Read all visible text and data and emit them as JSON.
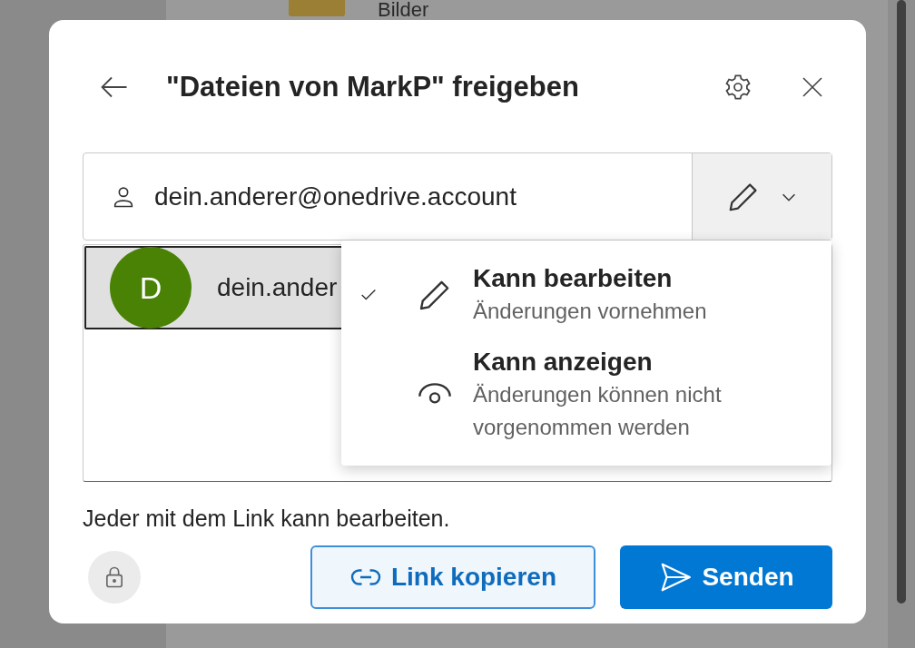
{
  "background": {
    "folder_label": "Bilder"
  },
  "dialog": {
    "title": "\"Dateien von MarkP\" freigeben",
    "recipient_field": {
      "value": "dein.anderer@onedrive.account"
    },
    "suggestion": {
      "initial": "D",
      "color": "#498205",
      "name": "dein.ander",
      "selected": true
    },
    "permission_menu": [
      {
        "kind": "edit",
        "title": "Kann bearbeiten",
        "description": "Änderungen vornehmen",
        "selected": true
      },
      {
        "kind": "view",
        "title": "Kann anzeigen",
        "description": "Änderungen können nicht vorgenommen werden",
        "selected": false
      }
    ],
    "link_info": "Jeder mit dem Link kann bearbeiten.",
    "buttons": [
      {
        "kind": "copy",
        "label": "Link kopieren"
      },
      {
        "kind": "send",
        "label": "Senden"
      }
    ]
  }
}
